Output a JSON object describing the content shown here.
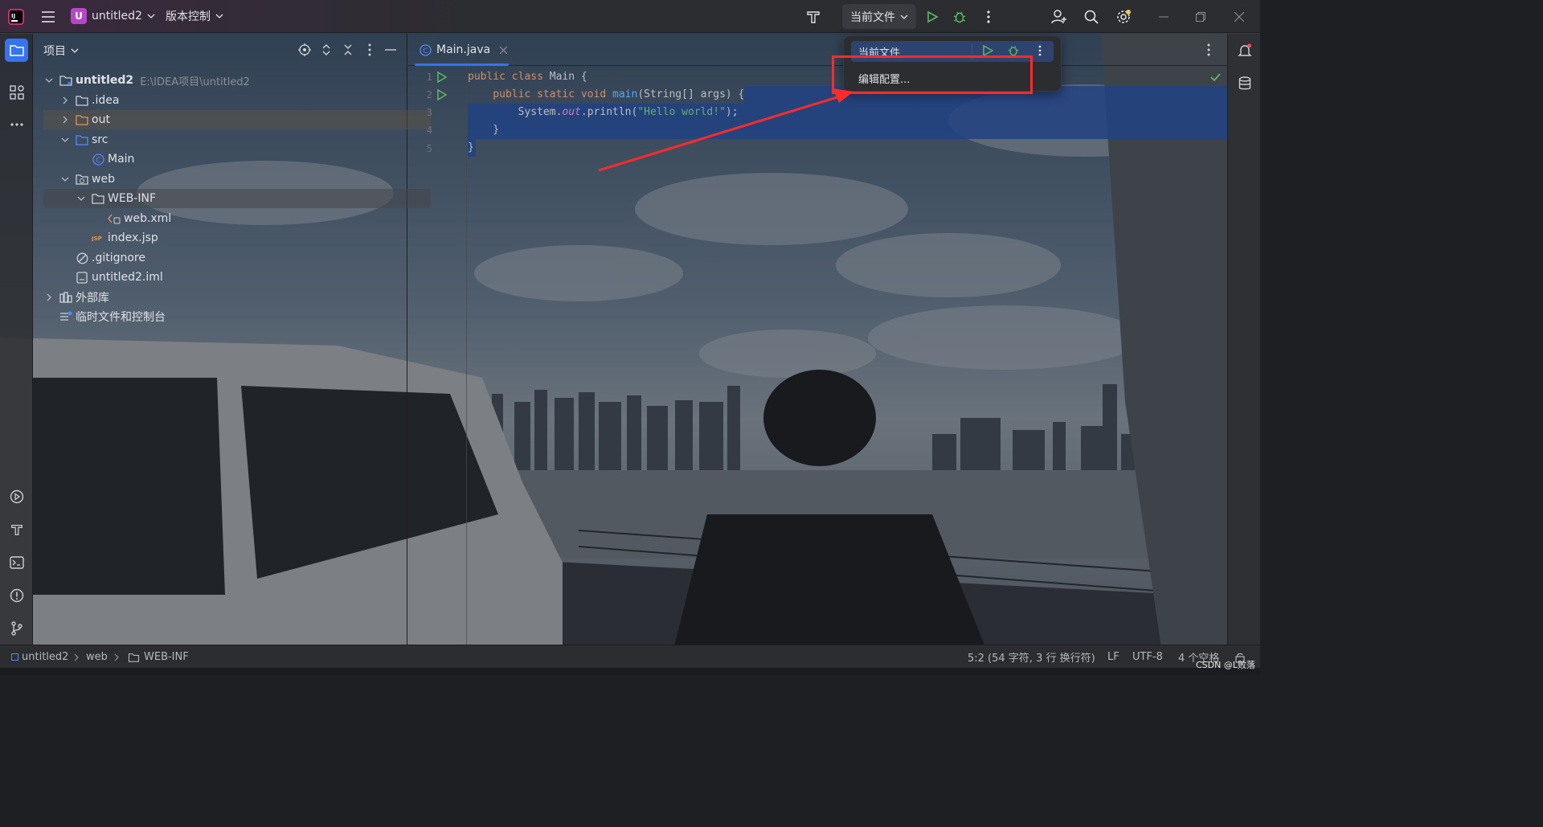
{
  "titlebar": {
    "project_badge": "U",
    "project_name": "untitled2",
    "vcs_menu": "版本控制",
    "run_config": "当前文件"
  },
  "project_panel": {
    "title": "项目",
    "tree": [
      {
        "label": "untitled2",
        "path": "E:\\IDEA项目\\untitled2"
      },
      {
        "label": ".idea"
      },
      {
        "label": "out"
      },
      {
        "label": "src"
      },
      {
        "label": "Main"
      },
      {
        "label": "web"
      },
      {
        "label": "WEB-INF"
      },
      {
        "label": "web.xml"
      },
      {
        "label": "index.jsp"
      },
      {
        "label": ".gitignore"
      },
      {
        "label": "untitled2.iml"
      },
      {
        "label": "外部库"
      },
      {
        "label": "临时文件和控制台"
      }
    ]
  },
  "editor": {
    "tab_label": "Main.java",
    "line_numbers": [
      "1",
      "2",
      "3",
      "4",
      "5"
    ],
    "code": {
      "l1_kw": "public class ",
      "l1_rest": "Main {",
      "l2_kw": "    public static void ",
      "l2_fn": "main",
      "l2_rest": "(String[] args) {",
      "l3_a": "        System.",
      "l3_fld": "out",
      "l3_b": ".println(",
      "l3_str": "\"Hello world!\"",
      "l3_c": ");",
      "l4": "    }",
      "l5": "}"
    }
  },
  "popup": {
    "selected": "当前文件",
    "item": "编辑配置..."
  },
  "statusbar": {
    "crumb1": "untitled2",
    "crumb2": "web",
    "crumb3": "WEB-INF",
    "position": "5:2 (54 字符, 3 行 换行符)",
    "line_sep": "LF",
    "encoding": "UTF-8",
    "indent": "4 个空格"
  },
  "watermark": "CSDN @L败落",
  "colors": {
    "accent": "#3574f0",
    "annotation_red": "#ff2b2b",
    "run_green": "#5fb865"
  }
}
